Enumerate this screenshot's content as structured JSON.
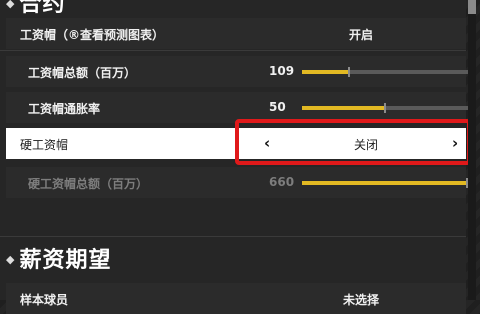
{
  "sections": {
    "contract_title": "合约",
    "salary_title": "薪资期望"
  },
  "rows": [
    {
      "label": "工资帽（®查看预测图表）",
      "value": "开启"
    },
    {
      "label": "工资帽总额（百万）",
      "value": "109",
      "level": 0.28
    },
    {
      "label": "工资帽通胀率",
      "value": "50",
      "level": 0.5
    },
    {
      "label": "硬工资帽",
      "value": "关闭",
      "arrow_left": "‹",
      "arrow_right": "›"
    },
    {
      "label": "硬工资帽总额（百万）",
      "value": "660",
      "level": 1.0
    }
  ],
  "salary_row": {
    "label": "样本球员",
    "value": "未选择"
  },
  "colors": {
    "accent": "#e2b923",
    "highlight_border": "#e0191a"
  }
}
